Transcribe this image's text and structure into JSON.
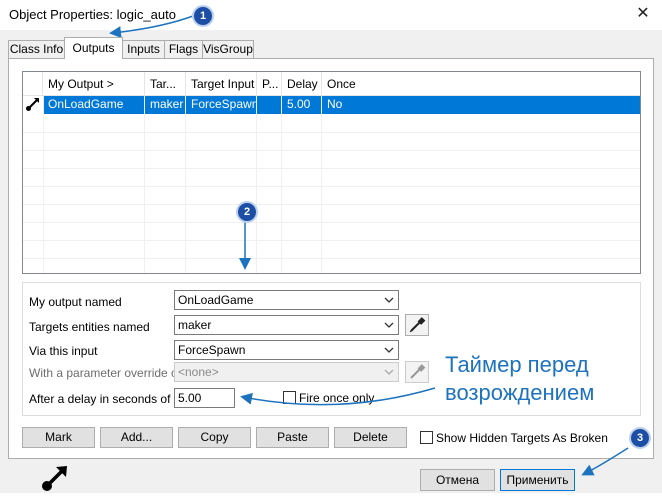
{
  "window": {
    "title": "Object Properties: logic_auto"
  },
  "tabs": [
    {
      "label": "Class Info"
    },
    {
      "label": "Outputs"
    },
    {
      "label": "Inputs"
    },
    {
      "label": "Flags"
    },
    {
      "label": "VisGroup"
    }
  ],
  "outputs_table": {
    "columns": [
      "My Output  >",
      "Tar...",
      "Target Input",
      "P...",
      "Delay",
      "Once"
    ],
    "rows": [
      {
        "my_output": "OnLoadGame",
        "target": "maker",
        "target_input": "ForceSpawn",
        "param": "",
        "delay": "5.00",
        "once": "No",
        "selected": true,
        "icon": "output-connection-icon"
      }
    ]
  },
  "editor": {
    "output_named_label": "My output named",
    "output_named_value": "OnLoadGame",
    "targets_label": "Targets entities named",
    "targets_value": "maker",
    "via_input_label": "Via this input",
    "via_input_value": "ForceSpawn",
    "param_override_label": "With a parameter override of",
    "param_override_value": "<none>",
    "delay_label": "After a delay in seconds of",
    "delay_value": "5.00",
    "fire_once_label": "Fire once only",
    "fire_once_checked": false
  },
  "actions": {
    "mark": "Mark",
    "add": "Add...",
    "copy": "Copy",
    "paste": "Paste",
    "delete": "Delete",
    "show_hidden_label": "Show Hidden Targets As Broken",
    "show_hidden_checked": false
  },
  "footer": {
    "cancel": "Отмена",
    "apply": "Применить"
  },
  "annotations": {
    "badge1": "1",
    "badge2": "2",
    "badge3": "3",
    "note_line1": "Таймер перед",
    "note_line2": "возрождением",
    "accent_color": "#1e73be",
    "selection_color": "#0078d7"
  }
}
